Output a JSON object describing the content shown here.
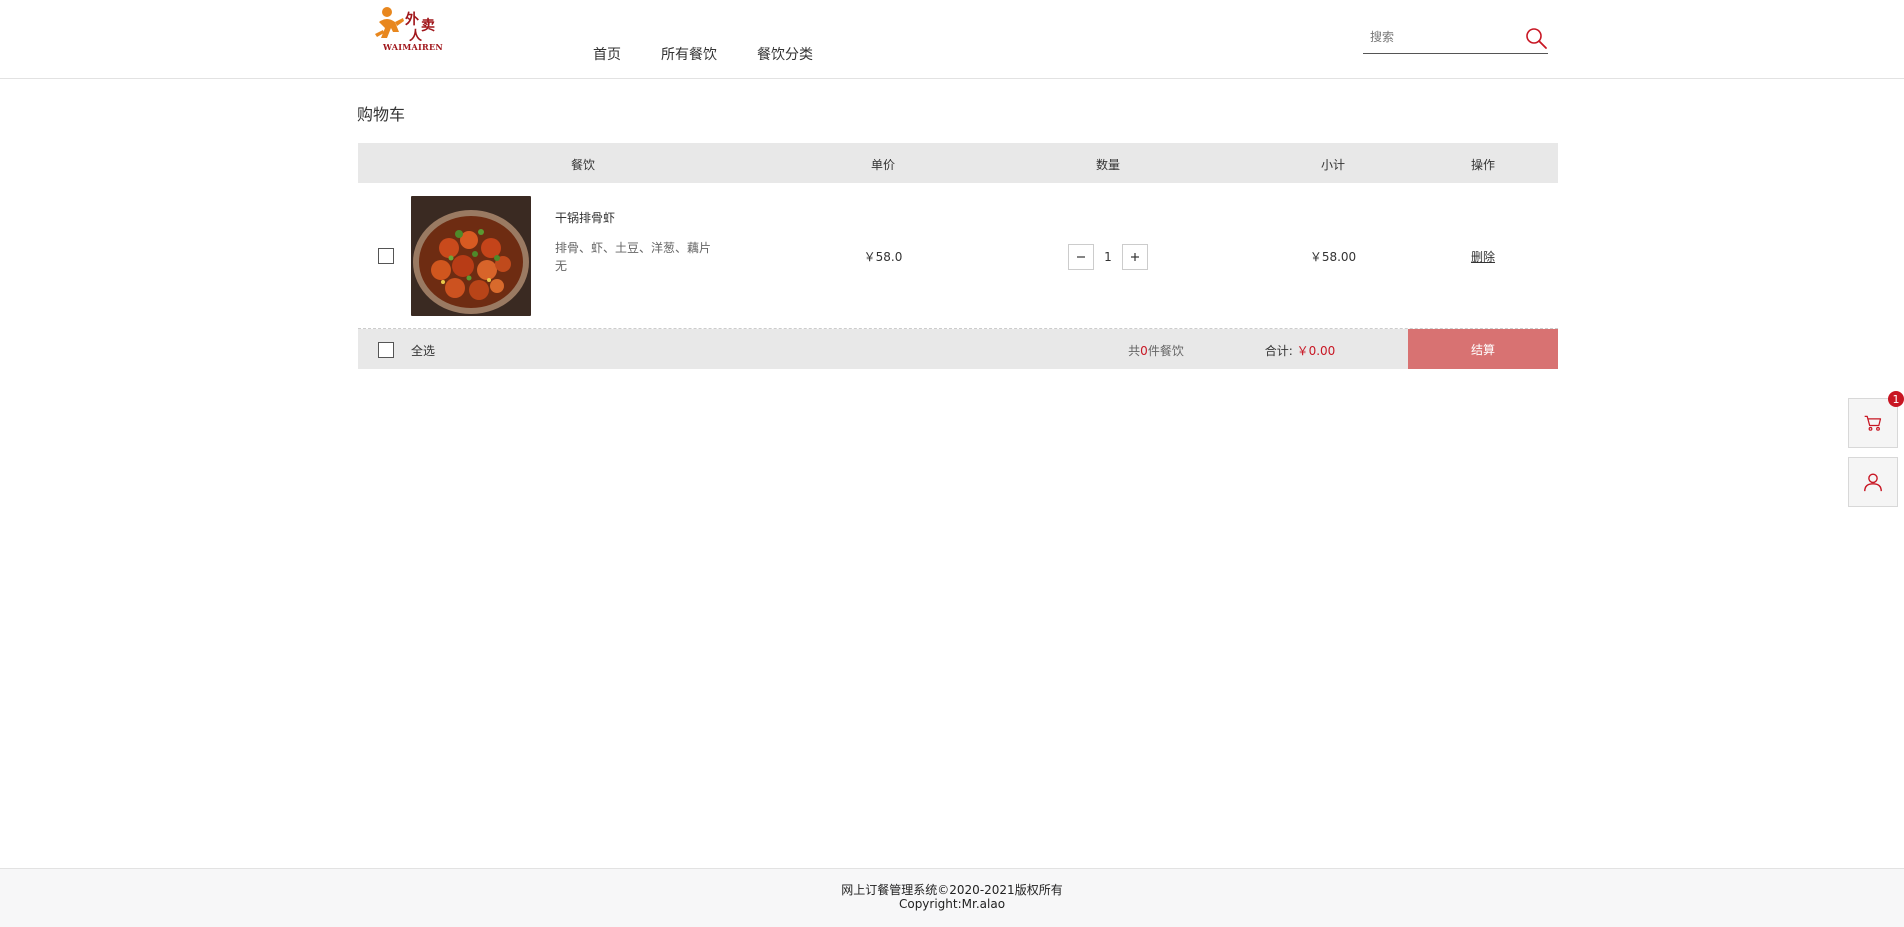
{
  "header": {
    "logo_text": "WAIMAIREN",
    "logo_alt": "外卖人",
    "nav": [
      "首页",
      "所有餐饮",
      "餐饮分类"
    ],
    "search_placeholder": "搜索"
  },
  "page_title": "购物车",
  "table": {
    "columns": [
      "餐饮",
      "单价",
      "数量",
      "小计",
      "操作"
    ],
    "rows": [
      {
        "name": "干锅排骨虾",
        "desc_line1": "排骨、虾、土豆、洋葱、藕片",
        "desc_line2": "无",
        "price": "￥58.0",
        "quantity": "1",
        "subtotal": "￥58.00",
        "action": "删除",
        "checked": false
      }
    ]
  },
  "footer_bar": {
    "select_all": "全选",
    "count_prefix": "共",
    "count_value": "0",
    "count_suffix": "件餐饮",
    "total_label": "合计:",
    "total_value": "￥0.00",
    "checkout": "结算"
  },
  "float": {
    "cart_badge": "1"
  },
  "page_footer": {
    "line1": "网上订餐管理系统©2020-2021版权所有",
    "line2": "Copyright:Mr.alao"
  },
  "colors": {
    "brand_red": "#c81623",
    "checkout_bg": "#d87272",
    "table_header_bg": "#e8e8e8",
    "logo_orange": "#e8871e"
  },
  "icons": {
    "search": "search-icon",
    "cart": "cart-icon",
    "user": "user-icon",
    "minus": "minus-icon",
    "plus": "plus-icon"
  }
}
